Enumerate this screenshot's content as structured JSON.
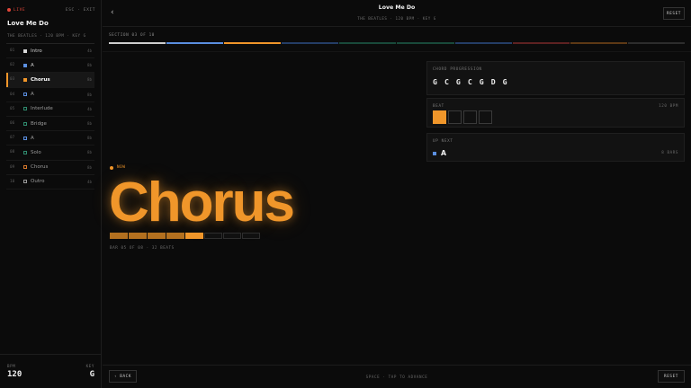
{
  "sidebar": {
    "live_label": "LIVE",
    "exit_label": "ESC · EXIT",
    "song_title": "Love Me Do",
    "song_meta": "THE BEATLES · 120 BPM · KEY G",
    "sections": [
      {
        "num": "01",
        "name": "Intro",
        "bars": "4b",
        "color": "#d9d9d9",
        "state": "done"
      },
      {
        "num": "02",
        "name": "A",
        "bars": "8b",
        "color": "#5b8fe0",
        "state": "done"
      },
      {
        "num": "03",
        "name": "Chorus",
        "bars": "8b",
        "color": "#f0962a",
        "state": "active"
      },
      {
        "num": "04",
        "name": "A",
        "bars": "8b",
        "color": "#5b8fe0",
        "state": "upcoming"
      },
      {
        "num": "05",
        "name": "Interlude",
        "bars": "4b",
        "color": "#2f8a6e",
        "state": "upcoming"
      },
      {
        "num": "06",
        "name": "Bridge",
        "bars": "8b",
        "color": "#2f8a6e",
        "state": "upcoming"
      },
      {
        "num": "07",
        "name": "A",
        "bars": "8b",
        "color": "#5b8fe0",
        "state": "upcoming"
      },
      {
        "num": "08",
        "name": "Solo",
        "bars": "8b",
        "color": "#2f8a6e",
        "state": "upcoming"
      },
      {
        "num": "09",
        "name": "Chorus",
        "bars": "8b",
        "color": "#d97a2c",
        "state": "upcoming"
      },
      {
        "num": "10",
        "name": "Outro",
        "bars": "4b",
        "color": "#9a9a9a",
        "state": "upcoming"
      }
    ],
    "bpm_label": "BPM",
    "bpm_value": "120",
    "key_label": "KEY",
    "key_value": "G"
  },
  "header": {
    "title": "Love Me Do",
    "meta": "THE BEATLES · 120 BPM · KEY G",
    "reset_label": "RESET",
    "back_icon": "chevron-left-icon"
  },
  "main": {
    "section_counter": "SECTION 03 OF 10",
    "progress_segments": [
      {
        "color": "#cfcfcf",
        "state": "done"
      },
      {
        "color": "#5b8fe0",
        "state": "done"
      },
      {
        "color": "#f0962a",
        "state": "active"
      },
      {
        "color": "#2d4f86",
        "state": "upcoming"
      },
      {
        "color": "#1f5f4b",
        "state": "upcoming"
      },
      {
        "color": "#1f5f4b",
        "state": "upcoming"
      },
      {
        "color": "#2d4f86",
        "state": "upcoming"
      },
      {
        "color": "#7a2a2a",
        "state": "upcoming"
      },
      {
        "color": "#7a4a1a",
        "state": "upcoming"
      },
      {
        "color": "#3a3a3a",
        "state": "upcoming"
      }
    ],
    "now_label": "NOW",
    "current_section": "Chorus",
    "bars": [
      "done",
      "done",
      "done",
      "done",
      "cur",
      "empty",
      "empty",
      "empty"
    ],
    "bar_meta": "BAR 05 OF 08 · 32 BEATS"
  },
  "panels": {
    "chord_label": "CHORD PROGRESSION",
    "chords": [
      "G",
      "C",
      "G",
      "C",
      "G",
      "D",
      "G"
    ],
    "beat_label": "BEAT",
    "beat_bpm": "120 BPM",
    "beats": [
      true,
      false,
      false,
      false
    ],
    "next_label": "UP NEXT",
    "next_name": "A",
    "next_color": "#5b8fe0",
    "next_bars": "8 BARS"
  },
  "footer": {
    "back_label": "‹ BACK",
    "hint": "SPACE · TAP TO ADVANCE",
    "reset_label": "RESET"
  }
}
